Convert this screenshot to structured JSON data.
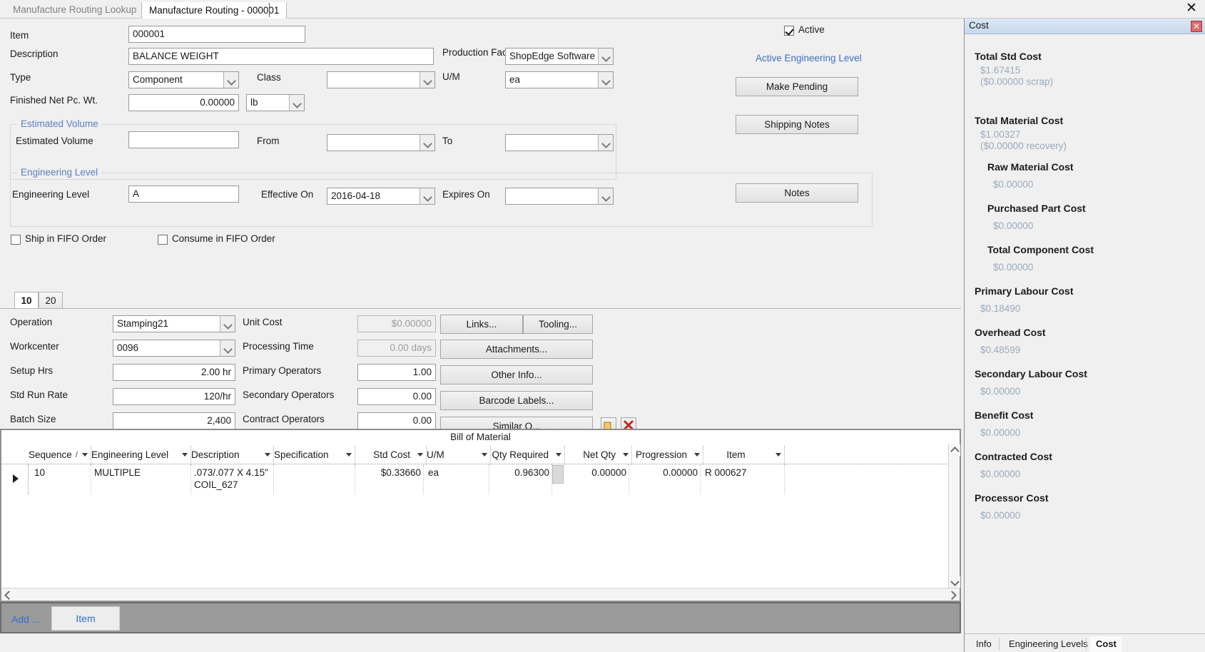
{
  "window": {
    "tabs": [
      {
        "label": "Manufacture Routing Lookup",
        "active": false
      },
      {
        "label": "Manufacture Routing - 000001",
        "active": true
      }
    ],
    "close_label": "✕"
  },
  "form": {
    "item": {
      "label": "Item",
      "value": "000001"
    },
    "description": {
      "label": "Description",
      "value": "BALANCE WEIGHT"
    },
    "type": {
      "label": "Type",
      "value": "Component"
    },
    "class": {
      "label": "Class",
      "value": ""
    },
    "finished_net_pc_wt": {
      "label": "Finished Net Pc. Wt.",
      "value": "0.00000",
      "uom": "lb"
    },
    "production_facility": {
      "label": "Production Facility",
      "value": "ShopEdge Software"
    },
    "um": {
      "label": "U/M",
      "value": "ea"
    },
    "active": {
      "label": "Active",
      "checked": true
    },
    "active_engineering_level_link": "Active Engineering Level",
    "make_pending_button": "Make Pending",
    "shipping_notes_button": "Shipping Notes",
    "estimated_volume_group": {
      "title": "Estimated Volume",
      "field_label": "Estimated Volume",
      "value": "",
      "from_label": "From",
      "from_value": "",
      "to_label": "To",
      "to_value": ""
    },
    "engineering_level_group": {
      "title": "Engineering Level",
      "field_label": "Engineering Level",
      "value": "A",
      "effective_on_label": "Effective On",
      "effective_on_value": "2016-04-18",
      "expires_on_label": "Expires On",
      "expires_on_value": "",
      "notes_button": "Notes"
    },
    "ship_in_fifo": {
      "label": "Ship in FIFO Order",
      "checked": false
    },
    "consume_in_fifo": {
      "label": "Consume in FIFO Order",
      "checked": false
    }
  },
  "operations": {
    "tabs": [
      {
        "label": "10",
        "selected": true
      },
      {
        "label": "20",
        "selected": false
      }
    ],
    "fields": {
      "operation": {
        "label": "Operation",
        "value": "Stamping21"
      },
      "workcenter": {
        "label": "Workcenter",
        "value": "0096"
      },
      "setup_hrs": {
        "label": "Setup Hrs",
        "value": "2.00 hr"
      },
      "std_run_rate": {
        "label": "Std Run Rate",
        "value": "120/hr"
      },
      "batch_size": {
        "label": "Batch Size",
        "value": "2,400"
      },
      "unit_cost": {
        "label": "Unit Cost",
        "value": "$0.00000"
      },
      "processing_time": {
        "label": "Processing Time",
        "value": "0.00 days"
      },
      "primary_operators": {
        "label": "Primary Operators",
        "value": "1.00"
      },
      "secondary_operators": {
        "label": "Secondary Operators",
        "value": "0.00"
      },
      "contract_operators": {
        "label": "Contract Operators",
        "value": "0.00"
      }
    },
    "buttons": {
      "links": "Links...",
      "tooling": "Tooling...",
      "attachments": "Attachments...",
      "other_info": "Other Info...",
      "barcode_labels": "Barcode Labels...",
      "similar_ops": "Similar O..."
    }
  },
  "bom": {
    "title": "Bill of Material",
    "columns": [
      "Sequence",
      "Engineering Level",
      "Description",
      "Specification",
      "Std Cost",
      "U/M",
      "Qty Required",
      "Net Qty",
      "Progression",
      "Item"
    ],
    "rows": [
      {
        "sequence": "10",
        "engineering_level": "MULTIPLE",
        "description": ".073/.077 X 4.15\"\nCOIL_627",
        "specification": "",
        "std_cost": "$0.33660",
        "um": "ea",
        "qty_required": "0.96300",
        "net_qty": "0.00000",
        "progression": "0.00000",
        "item": "R 000627"
      }
    ]
  },
  "action_bar": {
    "add_link": "Add ...",
    "item_button": "Item"
  },
  "cost_panel": {
    "title": "Cost",
    "close_label": "✕",
    "items": [
      {
        "name": "Total Std Cost",
        "value": "$1.67415\n($0.00000 scrap)",
        "indent": 0
      },
      {
        "name": "Total Material Cost",
        "value": "$1.00327\n($0.00000 recovery)",
        "indent": 0
      },
      {
        "name": "Raw Material Cost",
        "value": "$0.00000",
        "indent": 1
      },
      {
        "name": "Purchased Part Cost",
        "value": "$0.00000",
        "indent": 1
      },
      {
        "name": "Total Component Cost",
        "value": "$0.00000",
        "indent": 1
      },
      {
        "name": "Primary Labour Cost",
        "value": "$0.18490",
        "indent": 0
      },
      {
        "name": "Overhead Cost",
        "value": "$0.48599",
        "indent": 0
      },
      {
        "name": "Secondary Labour Cost",
        "value": "$0.00000",
        "indent": 0
      },
      {
        "name": "Benefit Cost",
        "value": "$0.00000",
        "indent": 0
      },
      {
        "name": "Contracted Cost",
        "value": "$0.00000",
        "indent": 0
      },
      {
        "name": "Processor Cost",
        "value": "$0.00000",
        "indent": 0
      }
    ],
    "tabs": [
      {
        "label": "Info",
        "selected": false
      },
      {
        "label": "Engineering Levels",
        "selected": false
      },
      {
        "label": "Cost",
        "selected": true
      }
    ]
  }
}
